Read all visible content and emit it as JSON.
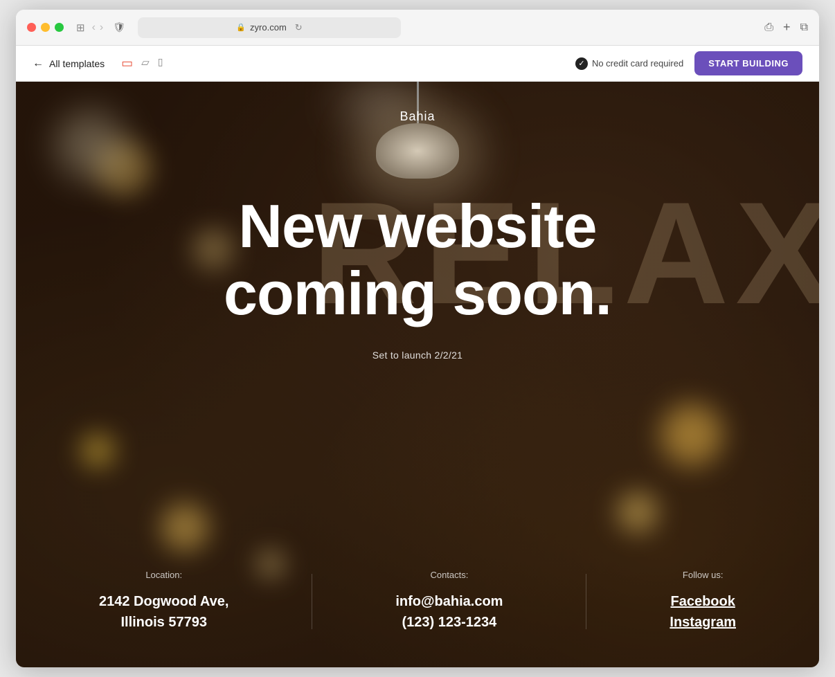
{
  "browser": {
    "url": "zyro.com",
    "reload_icon": "↻"
  },
  "toolbar": {
    "back_label": "All templates",
    "no_credit_card": "No credit card required",
    "start_building": "START BUILDING",
    "devices": [
      "desktop",
      "tablet",
      "mobile"
    ]
  },
  "site": {
    "name": "Bahia",
    "headline_line1": "New website",
    "headline_line2": "coming soon.",
    "launch_date": "Set to launch 2/2/21",
    "relax_bg": "RELAX",
    "footer": {
      "location_label": "Location:",
      "location_value_line1": "2142 Dogwood Ave,",
      "location_value_line2": "Illinois 57793",
      "contacts_label": "Contacts:",
      "email": "info@bahia.com",
      "phone": "(123) 123-1234",
      "follow_label": "Follow us:",
      "social_facebook": "Facebook",
      "social_instagram": "Instagram"
    }
  }
}
